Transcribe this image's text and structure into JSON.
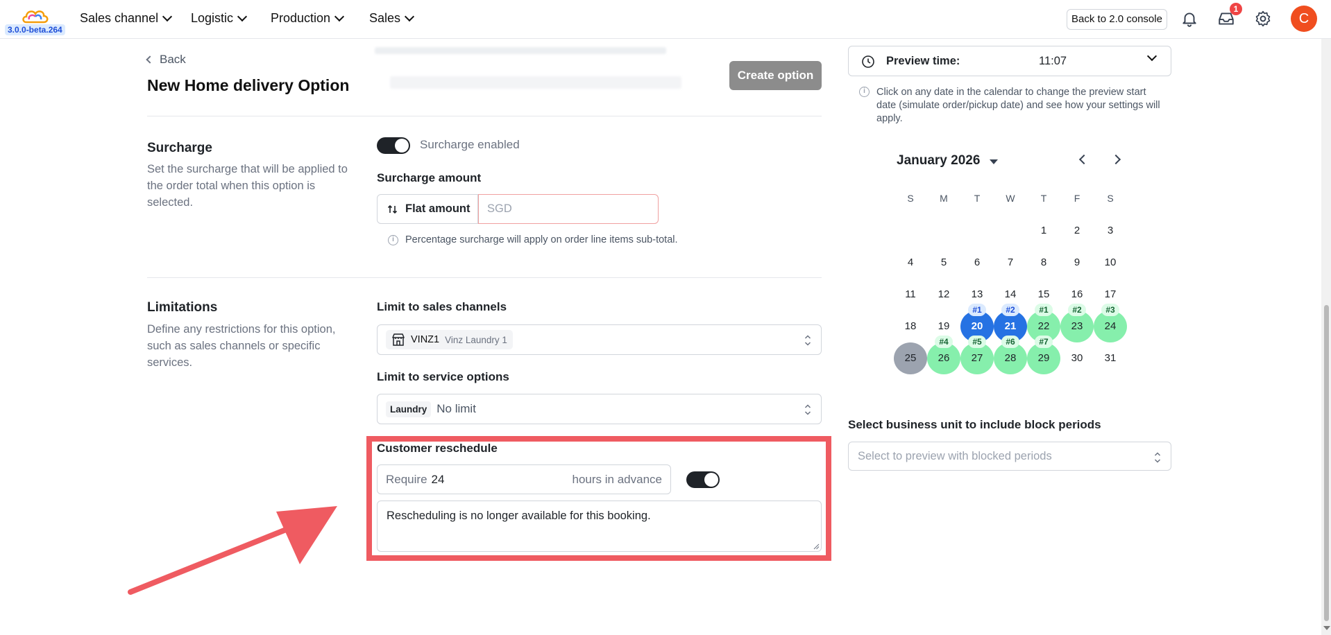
{
  "app": {
    "version": "3.0.0-beta.264",
    "nav": [
      "Sales channel",
      "Logistic",
      "Production",
      "Sales"
    ],
    "console_button": "Back to 2.0 console",
    "inbox_badge": "1",
    "avatar_letter": "C"
  },
  "page": {
    "back": "Back",
    "title_prefix": "New ",
    "title_strong": "Home delivery",
    "title_suffix": " Option",
    "create_button": "Create option"
  },
  "surcharge": {
    "title": "Surcharge",
    "description": "Set the surcharge that will be applied to the order total when this option is selected.",
    "toggle_label": "Surcharge enabled",
    "amount_label": "Surcharge amount",
    "type_button": "Flat amount",
    "amount_placeholder": "SGD",
    "hint": "Percentage surcharge will apply on order line items sub-total."
  },
  "limitations": {
    "title": "Limitations",
    "description": "Define any restrictions for this option, such as sales channels or specific services.",
    "channels_label": "Limit to sales channels",
    "channel_code": "VINZ1",
    "channel_name": "Vinz Laundry 1",
    "services_label": "Limit to service options",
    "service_chip": "Laundry",
    "service_value": "No limit"
  },
  "reschedule": {
    "label": "Customer reschedule",
    "prefix": "Require",
    "hours": "24",
    "suffix": "hours in advance",
    "message": "Rescheduling is no longer available for this booking."
  },
  "preview": {
    "label": "Preview time:",
    "time": "11:07",
    "description": "Click on any date in the calendar to change the preview start date (simulate order/pickup date) and see how your settings will apply.",
    "month": "January 2026",
    "weekdays": [
      "S",
      "M",
      "T",
      "W",
      "T",
      "F",
      "S"
    ],
    "days": [
      {
        "d": "1"
      },
      {
        "d": "2"
      },
      {
        "d": "3"
      },
      {
        "d": "4"
      },
      {
        "d": "5"
      },
      {
        "d": "6"
      },
      {
        "d": "7"
      },
      {
        "d": "8"
      },
      {
        "d": "9"
      },
      {
        "d": "10"
      },
      {
        "d": "11"
      },
      {
        "d": "12"
      },
      {
        "d": "13"
      },
      {
        "d": "14"
      },
      {
        "d": "15"
      },
      {
        "d": "16"
      },
      {
        "d": "17"
      },
      {
        "d": "18"
      },
      {
        "d": "19"
      },
      {
        "d": "20",
        "state": "blue",
        "tag": "#1"
      },
      {
        "d": "21",
        "state": "blue",
        "tag": "#2"
      },
      {
        "d": "22",
        "state": "green",
        "tag": "#1"
      },
      {
        "d": "23",
        "state": "green",
        "tag": "#2"
      },
      {
        "d": "24",
        "state": "green",
        "tag": "#3"
      },
      {
        "d": "25",
        "state": "gray"
      },
      {
        "d": "26",
        "state": "green",
        "tag": "#4"
      },
      {
        "d": "27",
        "state": "green",
        "tag": "#5"
      },
      {
        "d": "28",
        "state": "green",
        "tag": "#6"
      },
      {
        "d": "29",
        "state": "green",
        "tag": "#7"
      },
      {
        "d": "30"
      },
      {
        "d": "31"
      }
    ],
    "bu_label": "Select business unit to include block periods",
    "bu_placeholder": "Select to preview with blocked periods"
  },
  "colors": {
    "accent_blue": "#2672e3",
    "available_green": "#86efac",
    "highlight_red": "#ef5b61",
    "avatar": "#f04e1f"
  }
}
